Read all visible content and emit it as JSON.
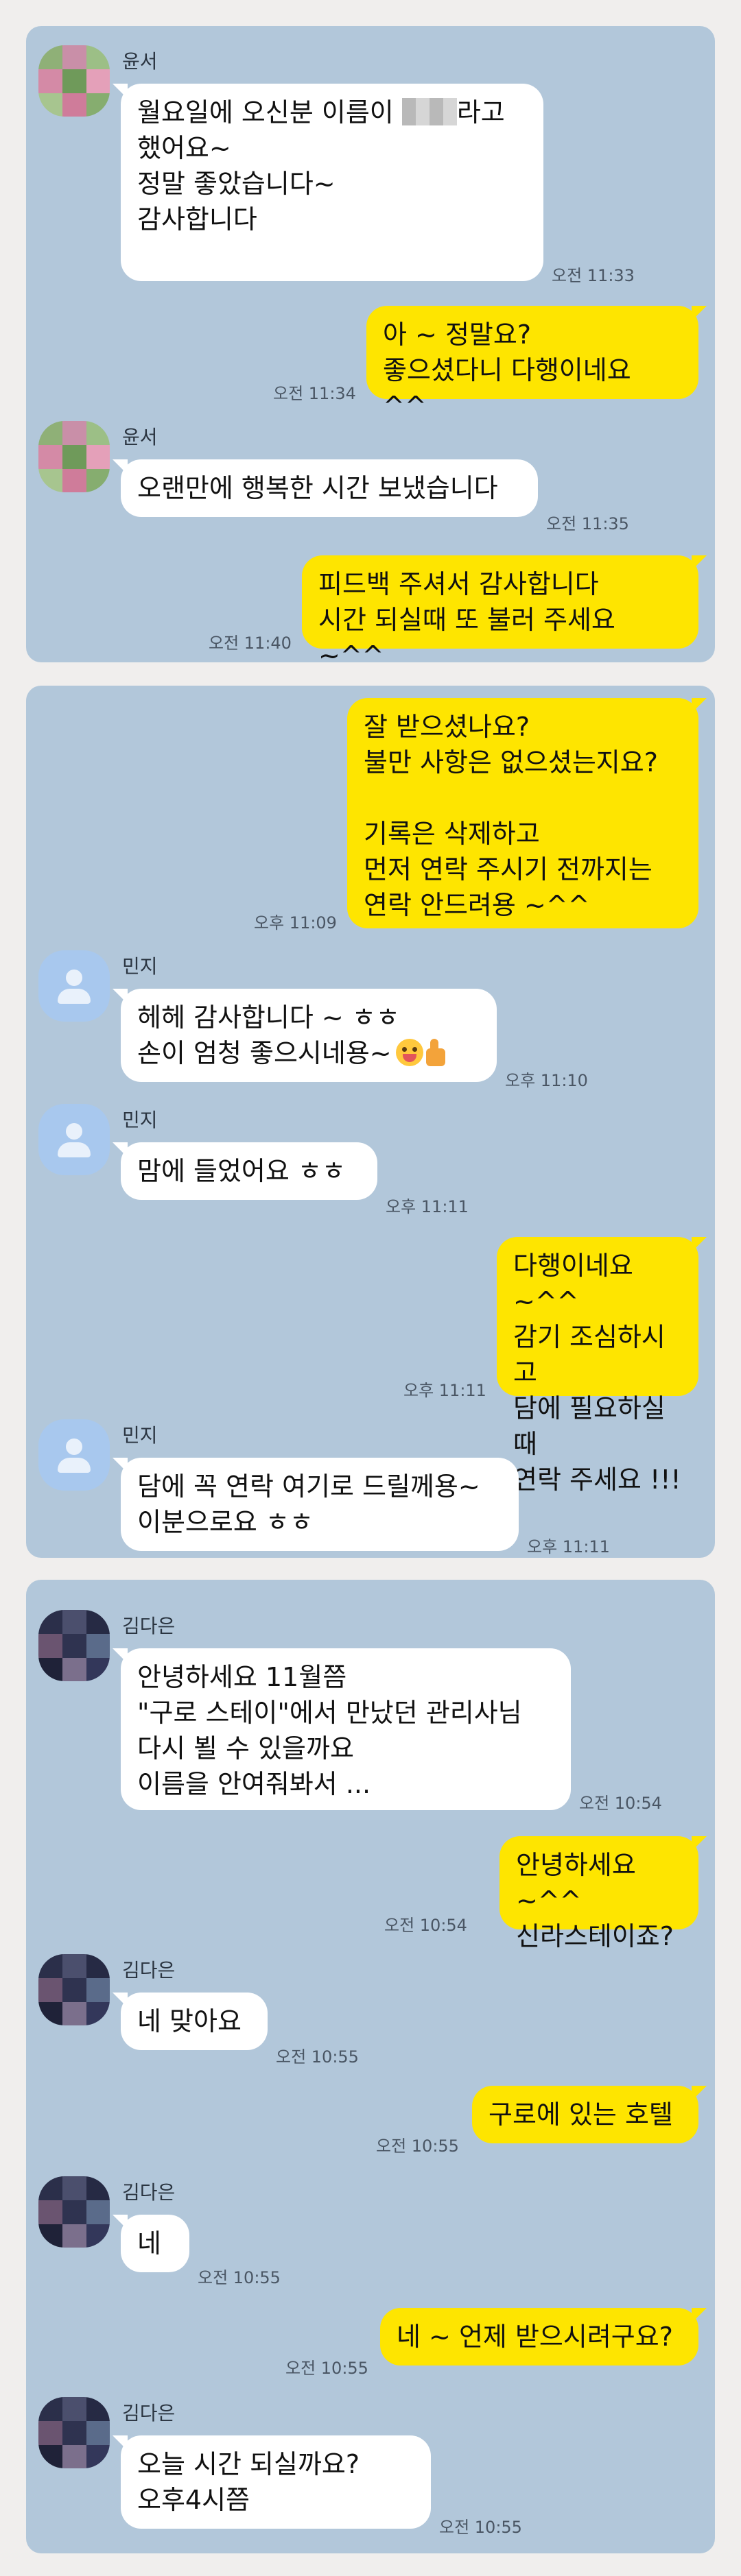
{
  "panel1": {
    "m1": {
      "sender": "윤서",
      "pre": "월요일에 오신분 이름이 ",
      "post": "라고\n했어요~\n정말 좋았습니다~\n감사합니다",
      "time": "오전 11:33"
    },
    "m2": {
      "text": "아 ~ 정말요?\n좋으셨다니 다행이네요 ^^",
      "time": "오전 11:34"
    },
    "m3": {
      "sender": "윤서",
      "text": "오랜만에 행복한 시간 보냈습니다",
      "time": "오전 11:35"
    },
    "m4": {
      "text": "피드백 주셔서 감사합니다\n시간 되실때 또 불러 주세요 ~^^",
      "time": "오전 11:40"
    }
  },
  "panel2": {
    "m1": {
      "text": "잘 받으셨나요?\n불만 사항은 없으셨는지요?\n\n기록은 삭제하고\n먼저 연락 주시기 전까지는\n연락 안드려용 ~^^",
      "time": "오후 11:09"
    },
    "m2": {
      "sender": "민지",
      "text": "헤헤 감사합니다 ~ ㅎㅎ\n손이 엄청 좋으시네용~",
      "time": "오후 11:10"
    },
    "m3": {
      "sender": "민지",
      "text": "맘에 들었어요 ㅎㅎ",
      "time": "오후 11:11"
    },
    "m4": {
      "text": "다행이네요 ~^^\n감기 조심하시고\n담에 필요하실때\n연락 주세요 !!!",
      "time": "오후 11:11"
    },
    "m5": {
      "sender": "민지",
      "text": "담에 꼭 연락 여기로 드릴께용~\n이분으로요 ㅎㅎ",
      "time": "오후 11:11"
    }
  },
  "panel3": {
    "m1": {
      "sender": "김다은",
      "text": "안녕하세요 11월쯤\n\"구로 스테이\"에서 만났던 관리사님\n다시 뵐 수 있을까요\n이름을 안여줘봐서 ...",
      "time": "오전 10:54"
    },
    "m2": {
      "text": "안녕하세요 ~^^\n신라스테이죠?",
      "time": "오전 10:54"
    },
    "m3": {
      "sender": "김다은",
      "text": "네 맞아요",
      "time": "오전 10:55"
    },
    "m4": {
      "text": "구로에 있는 호텔",
      "time": "오전 10:55"
    },
    "m5": {
      "sender": "김다은",
      "text": "네",
      "time": "오전 10:55"
    },
    "m6": {
      "text": "네 ~ 언제 받으시려구요?",
      "time": "오전 10:55"
    },
    "m7": {
      "sender": "김다은",
      "text": "오늘  시간 되실까요?\n오후4시쯤",
      "time": "오전 10:55"
    }
  },
  "colors": {
    "chat_background": "#b2c7da",
    "my_bubble": "#fee500",
    "their_bubble": "#ffffff",
    "page_background": "#f0eeed"
  },
  "icons": {
    "profile_pixelated": "pixelated-profile-photo",
    "profile_default": "default-person-icon",
    "emoji": [
      "tongue-face-emoji",
      "thumbs-up-emoji"
    ]
  }
}
